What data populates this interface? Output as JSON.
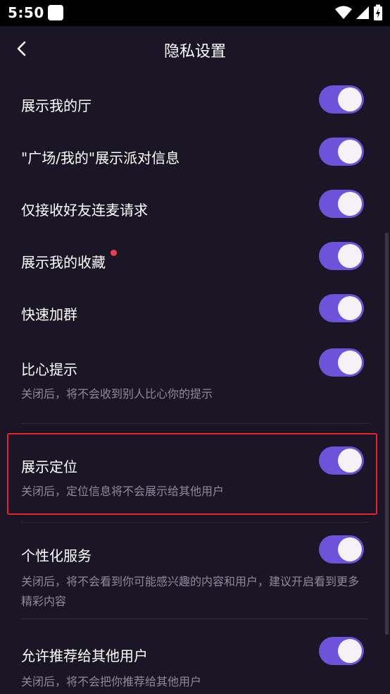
{
  "status": {
    "time": "5:50"
  },
  "header": {
    "title": "隐私设置"
  },
  "settings": [
    {
      "label": "展示我的厅",
      "on": true
    },
    {
      "label": "\"广场/我的\"展示派对信息",
      "on": true
    },
    {
      "label": "仅接收好友连麦请求",
      "on": true
    },
    {
      "label": "展示我的收藏",
      "on": true
    },
    {
      "label": "快速加群",
      "on": true
    },
    {
      "label": "比心提示",
      "desc": "关闭后，将不会收到别人比心你的提示",
      "on": true
    },
    {
      "label": "展示定位",
      "desc": "关闭后，定位信息将不会展示给其他用户",
      "on": true
    },
    {
      "label": "个性化服务",
      "desc": "关闭后，将不会看到你可能感兴趣的内容和用户，建议开启看到更多精彩内容",
      "on": true
    },
    {
      "label": "允许推荐给其他用户",
      "desc": "关闭后，将不会把你推荐给其他用户",
      "on": true
    }
  ],
  "colors": {
    "background": "#1a1625",
    "toggle_on": "#6e52d9",
    "highlight": "#e8232d",
    "dot": "#f23d4f"
  }
}
